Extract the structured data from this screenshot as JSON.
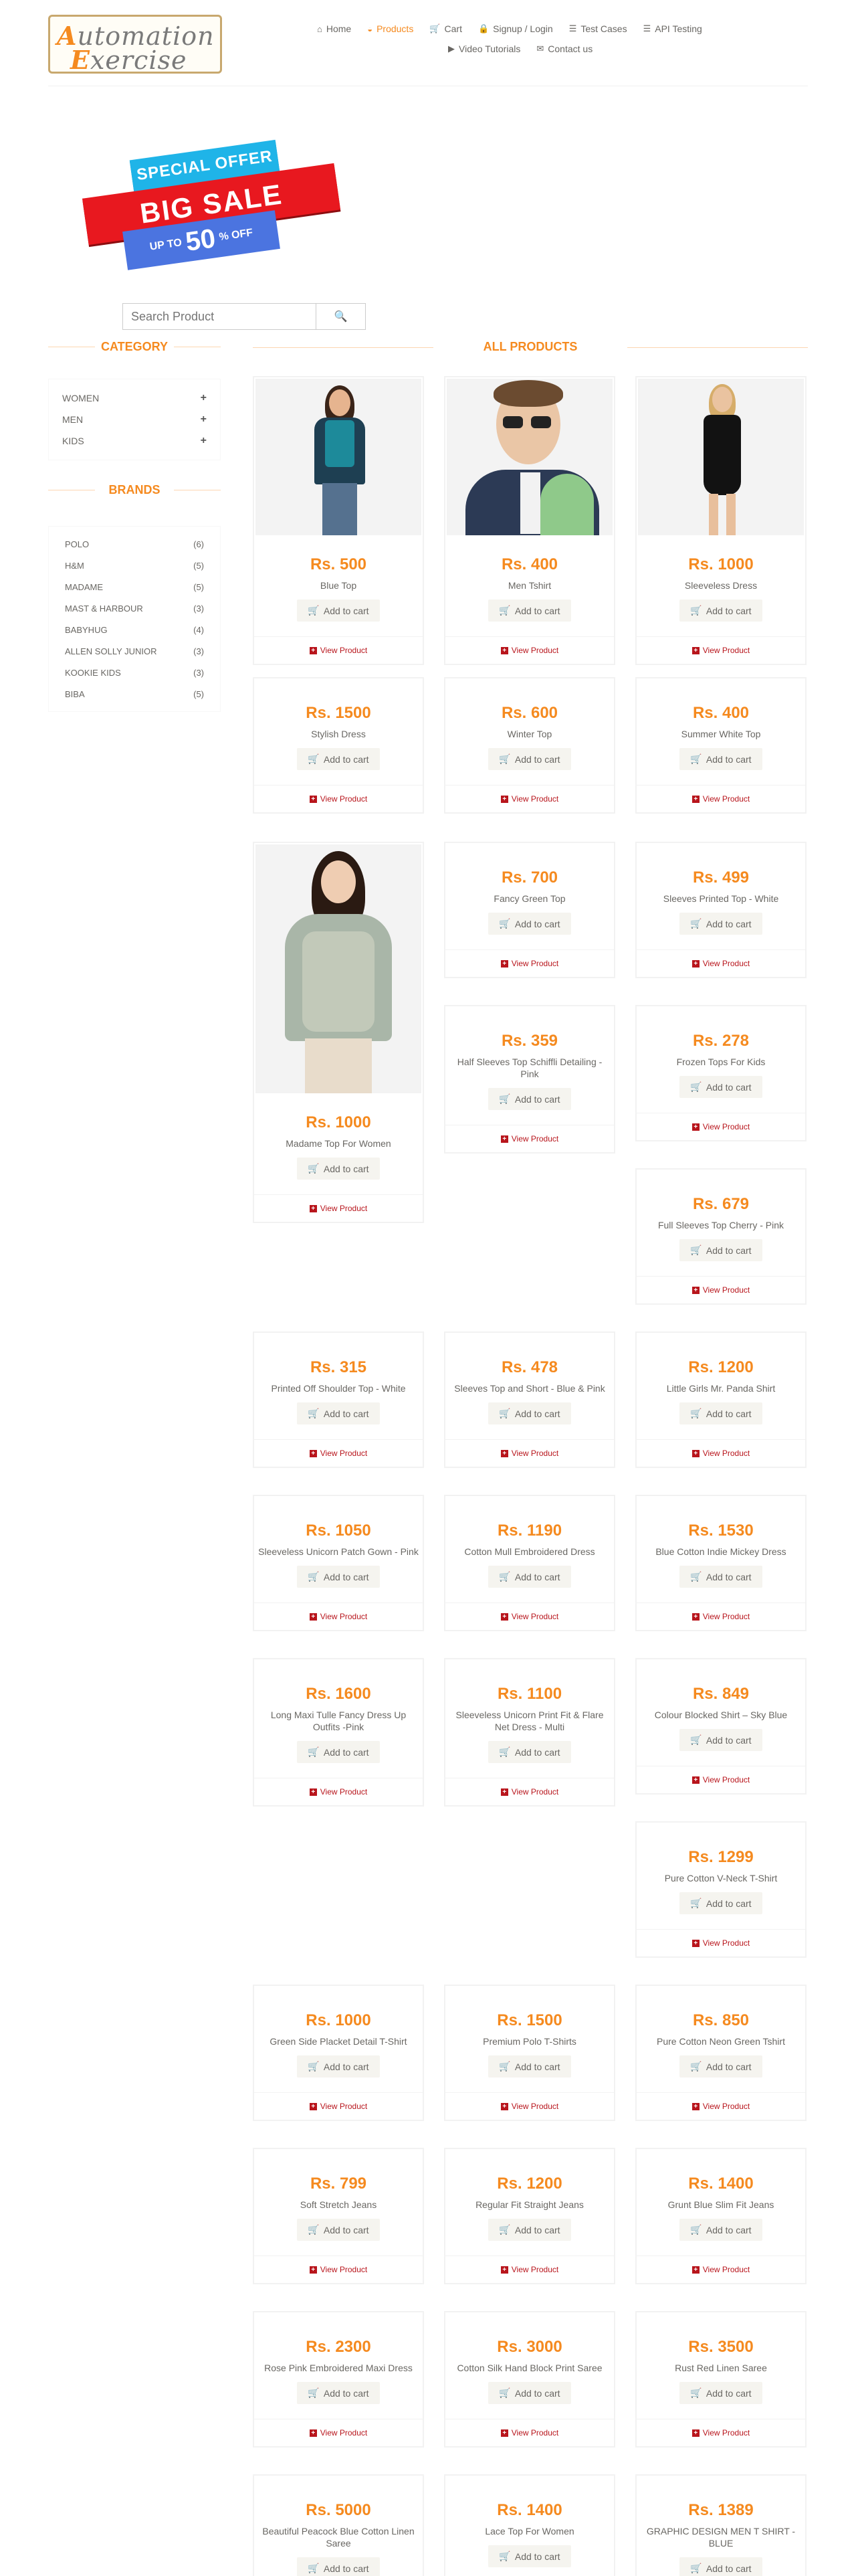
{
  "logo": {
    "line1": "Automation",
    "line2": "Exercise"
  },
  "nav": [
    {
      "label": "Home",
      "icon": "home-icon",
      "glyph": "⌂",
      "active": false
    },
    {
      "label": "Products",
      "icon": "products-icon",
      "glyph": "◒",
      "active": true
    },
    {
      "label": "Cart",
      "icon": "cart-icon",
      "glyph": "🛒",
      "active": false
    },
    {
      "label": "Signup / Login",
      "icon": "lock-icon",
      "glyph": "🔒",
      "active": false
    },
    {
      "label": "Test Cases",
      "icon": "list-icon",
      "glyph": "☰",
      "active": false
    },
    {
      "label": "API Testing",
      "icon": "list-icon",
      "glyph": "☰",
      "active": false
    },
    {
      "label": "Video Tutorials",
      "icon": "youtube-icon",
      "glyph": "▶",
      "active": false
    },
    {
      "label": "Contact us",
      "icon": "envelope-icon",
      "glyph": "✉",
      "active": false
    }
  ],
  "banner": {
    "line1": "SPECIAL OFFER",
    "line2": "BIG SALE",
    "upto": "UP TO",
    "percent": "50",
    "pct_off": "% OFF"
  },
  "search": {
    "placeholder": "Search Product"
  },
  "category": {
    "title": "CATEGORY",
    "items": [
      {
        "label": "WOMEN"
      },
      {
        "label": "MEN"
      },
      {
        "label": "KIDS"
      }
    ]
  },
  "brands": {
    "title": "BRANDS",
    "items": [
      {
        "label": "POLO",
        "count": "(6)"
      },
      {
        "label": "H&M",
        "count": "(5)"
      },
      {
        "label": "MADAME",
        "count": "(5)"
      },
      {
        "label": "MAST & HARBOUR",
        "count": "(3)"
      },
      {
        "label": "BABYHUG",
        "count": "(4)"
      },
      {
        "label": "ALLEN SOLLY JUNIOR",
        "count": "(3)"
      },
      {
        "label": "KOOKIE KIDS",
        "count": "(3)"
      },
      {
        "label": "BIBA",
        "count": "(5)"
      }
    ]
  },
  "products_title": "ALL PRODUCTS",
  "add_to_cart": "Add to cart",
  "view_product": "View Product",
  "products": [
    {
      "price": "Rs. 500",
      "name": "Blue Top"
    },
    {
      "price": "Rs. 400",
      "name": "Men Tshirt"
    },
    {
      "price": "Rs. 1000",
      "name": "Sleeveless Dress"
    },
    {
      "price": "Rs. 1500",
      "name": "Stylish Dress"
    },
    {
      "price": "Rs. 600",
      "name": "Winter Top"
    },
    {
      "price": "Rs. 400",
      "name": "Summer White Top"
    },
    {
      "price": "Rs. 1000",
      "name": "Madame Top For Women"
    },
    {
      "price": "Rs. 700",
      "name": "Fancy Green Top"
    },
    {
      "price": "Rs. 499",
      "name": "Sleeves Printed Top - White"
    },
    {
      "price": "Rs. 359",
      "name": "Half Sleeves Top Schiffli Detailing - Pink"
    },
    {
      "price": "Rs. 278",
      "name": "Frozen Tops For Kids"
    },
    {
      "price": "Rs. 679",
      "name": "Full Sleeves Top Cherry - Pink"
    },
    {
      "price": "Rs. 315",
      "name": "Printed Off Shoulder Top - White"
    },
    {
      "price": "Rs. 478",
      "name": "Sleeves Top and Short - Blue & Pink"
    },
    {
      "price": "Rs. 1200",
      "name": "Little Girls Mr. Panda Shirt"
    },
    {
      "price": "Rs. 1050",
      "name": "Sleeveless Unicorn Patch Gown - Pink"
    },
    {
      "price": "Rs. 1190",
      "name": "Cotton Mull Embroidered Dress"
    },
    {
      "price": "Rs. 1530",
      "name": "Blue Cotton Indie Mickey Dress"
    },
    {
      "price": "Rs. 1600",
      "name": "Long Maxi Tulle Fancy Dress Up Outfits -Pink"
    },
    {
      "price": "Rs. 1100",
      "name": "Sleeveless Unicorn Print Fit & Flare Net Dress - Multi"
    },
    {
      "price": "Rs. 849",
      "name": "Colour Blocked Shirt – Sky Blue"
    },
    {
      "price": "Rs. 1299",
      "name": "Pure Cotton V-Neck T-Shirt"
    },
    {
      "price": "Rs. 1000",
      "name": "Green Side Placket Detail T-Shirt"
    },
    {
      "price": "Rs. 1500",
      "name": "Premium Polo T-Shirts"
    },
    {
      "price": "Rs. 850",
      "name": "Pure Cotton Neon Green Tshirt"
    },
    {
      "price": "Rs. 799",
      "name": "Soft Stretch Jeans"
    },
    {
      "price": "Rs. 1200",
      "name": "Regular Fit Straight Jeans"
    },
    {
      "price": "Rs. 1400",
      "name": "Grunt Blue Slim Fit Jeans"
    },
    {
      "price": "Rs. 2300",
      "name": "Rose Pink Embroidered Maxi Dress"
    },
    {
      "price": "Rs. 3000",
      "name": "Cotton Silk Hand Block Print Saree"
    },
    {
      "price": "Rs. 3500",
      "name": "Rust Red Linen Saree"
    },
    {
      "price": "Rs. 5000",
      "name": "Beautiful Peacock Blue Cotton Linen Saree"
    },
    {
      "price": "Rs. 1400",
      "name": "Lace Top For Women"
    },
    {
      "price": "Rs. 1389",
      "name": "GRAPHIC DESIGN MEN T SHIRT - BLUE"
    }
  ],
  "colors": {
    "accent": "#f58a1f",
    "link": "#b8151c",
    "text": "#696763"
  }
}
